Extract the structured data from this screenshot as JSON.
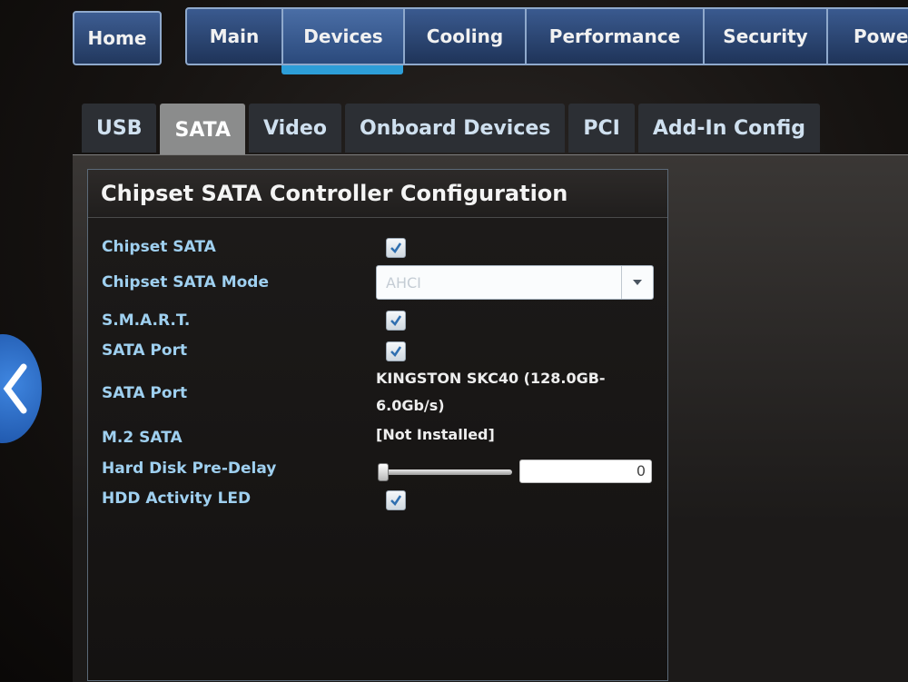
{
  "nav": {
    "home_label": "Home",
    "tabs": [
      {
        "label": "Main"
      },
      {
        "label": "Devices"
      },
      {
        "label": "Cooling"
      },
      {
        "label": "Performance"
      },
      {
        "label": "Security"
      },
      {
        "label": "Power"
      }
    ],
    "active_tab": "Devices"
  },
  "subtabs": [
    {
      "label": "USB"
    },
    {
      "label": "SATA"
    },
    {
      "label": "Video"
    },
    {
      "label": "Onboard Devices"
    },
    {
      "label": "PCI"
    },
    {
      "label": "Add-In Config"
    }
  ],
  "active_subtab": "SATA",
  "panel": {
    "title": "Chipset SATA Controller Configuration",
    "settings": {
      "chipset_sata": {
        "label": "Chipset SATA",
        "checked": true
      },
      "chipset_sata_mode": {
        "label": "Chipset SATA Mode",
        "value": "AHCI"
      },
      "smart": {
        "label": "S.M.A.R.T.",
        "checked": true
      },
      "sata_port_enable": {
        "label": "SATA Port",
        "checked": true
      },
      "sata_port_device": {
        "label": "SATA Port",
        "value_line1": "KINGSTON SKC40 (128.0GB-",
        "value_line2": "6.0Gb/s)"
      },
      "m2_sata": {
        "label": "M.2 SATA",
        "value": "[Not Installed]"
      },
      "hdd_predelay": {
        "label": "Hard Disk Pre-Delay",
        "value": "0"
      },
      "hdd_activity_led": {
        "label": "HDD Activity LED",
        "checked": true
      }
    }
  },
  "icons": {
    "back": "chevron-left-icon",
    "checkmark": "checkmark-icon",
    "dropdown": "chevron-down-icon"
  },
  "colors": {
    "accent": "#2d9ed8",
    "label": "#9fd0f0",
    "nav_bg": "#2b4a7c"
  }
}
